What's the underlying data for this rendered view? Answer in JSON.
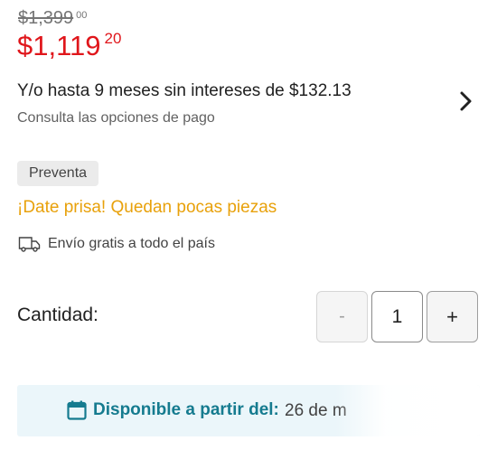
{
  "pricing": {
    "original_price": "$1,399",
    "original_cents": "00",
    "current_price": "$1,119",
    "current_cents": "20",
    "accent_color": "#e0161b"
  },
  "installments": {
    "title": "Y/o hasta 9 meses sin intereses de $132.13",
    "subtitle": "Consulta las opciones de pago",
    "chevron_icon": "chevron-right-icon"
  },
  "badge": {
    "label": "Preventa"
  },
  "stock_notice": {
    "text": "¡Date prisa! Quedan pocas piezas",
    "color": "#e8a10b"
  },
  "shipping": {
    "text": "Envío gratis a todo el país",
    "icon": "truck-icon"
  },
  "quantity": {
    "label": "Cantidad:",
    "minus_label": "-",
    "value": "1",
    "plus_label": "+"
  },
  "availability": {
    "icon": "calendar-icon",
    "label": "Disponible a partir del:",
    "date": "26 de m",
    "accent_color": "#157b8f"
  }
}
